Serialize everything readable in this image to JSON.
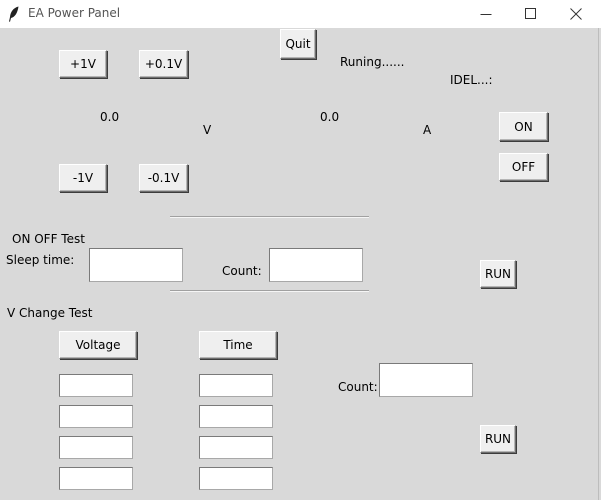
{
  "window": {
    "title": "EA Power Panel",
    "icon": "feather-icon",
    "controls": {
      "minimize": "minimize-icon",
      "maximize": "maximize-icon",
      "close": "close-icon"
    }
  },
  "toolbar": {
    "quit_label": "Quit",
    "plus_1v_label": "+1V",
    "plus_01v_label": "+0.1V",
    "minus_1v_label": "-1V",
    "minus_01v_label": "-0.1V",
    "on_label": "ON",
    "off_label": "OFF"
  },
  "status": {
    "running": "Runing......",
    "state": "IDEL...:"
  },
  "readout": {
    "voltage_value": "0.0",
    "voltage_unit": "V",
    "current_value": "0.0",
    "current_unit": "A"
  },
  "on_off_test": {
    "title": "ON OFF Test",
    "sleep_label": "Sleep time:",
    "sleep_value": "",
    "count_label": "Count:",
    "count_value": "",
    "run_label": "RUN"
  },
  "v_change_test": {
    "title": "V Change Test",
    "voltage_header": "Voltage",
    "time_header": "Time",
    "voltages": [
      "",
      "",
      "",
      ""
    ],
    "times": [
      "",
      "",
      "",
      ""
    ],
    "count_label": "Count:",
    "count_value": "",
    "run_label": "RUN"
  }
}
